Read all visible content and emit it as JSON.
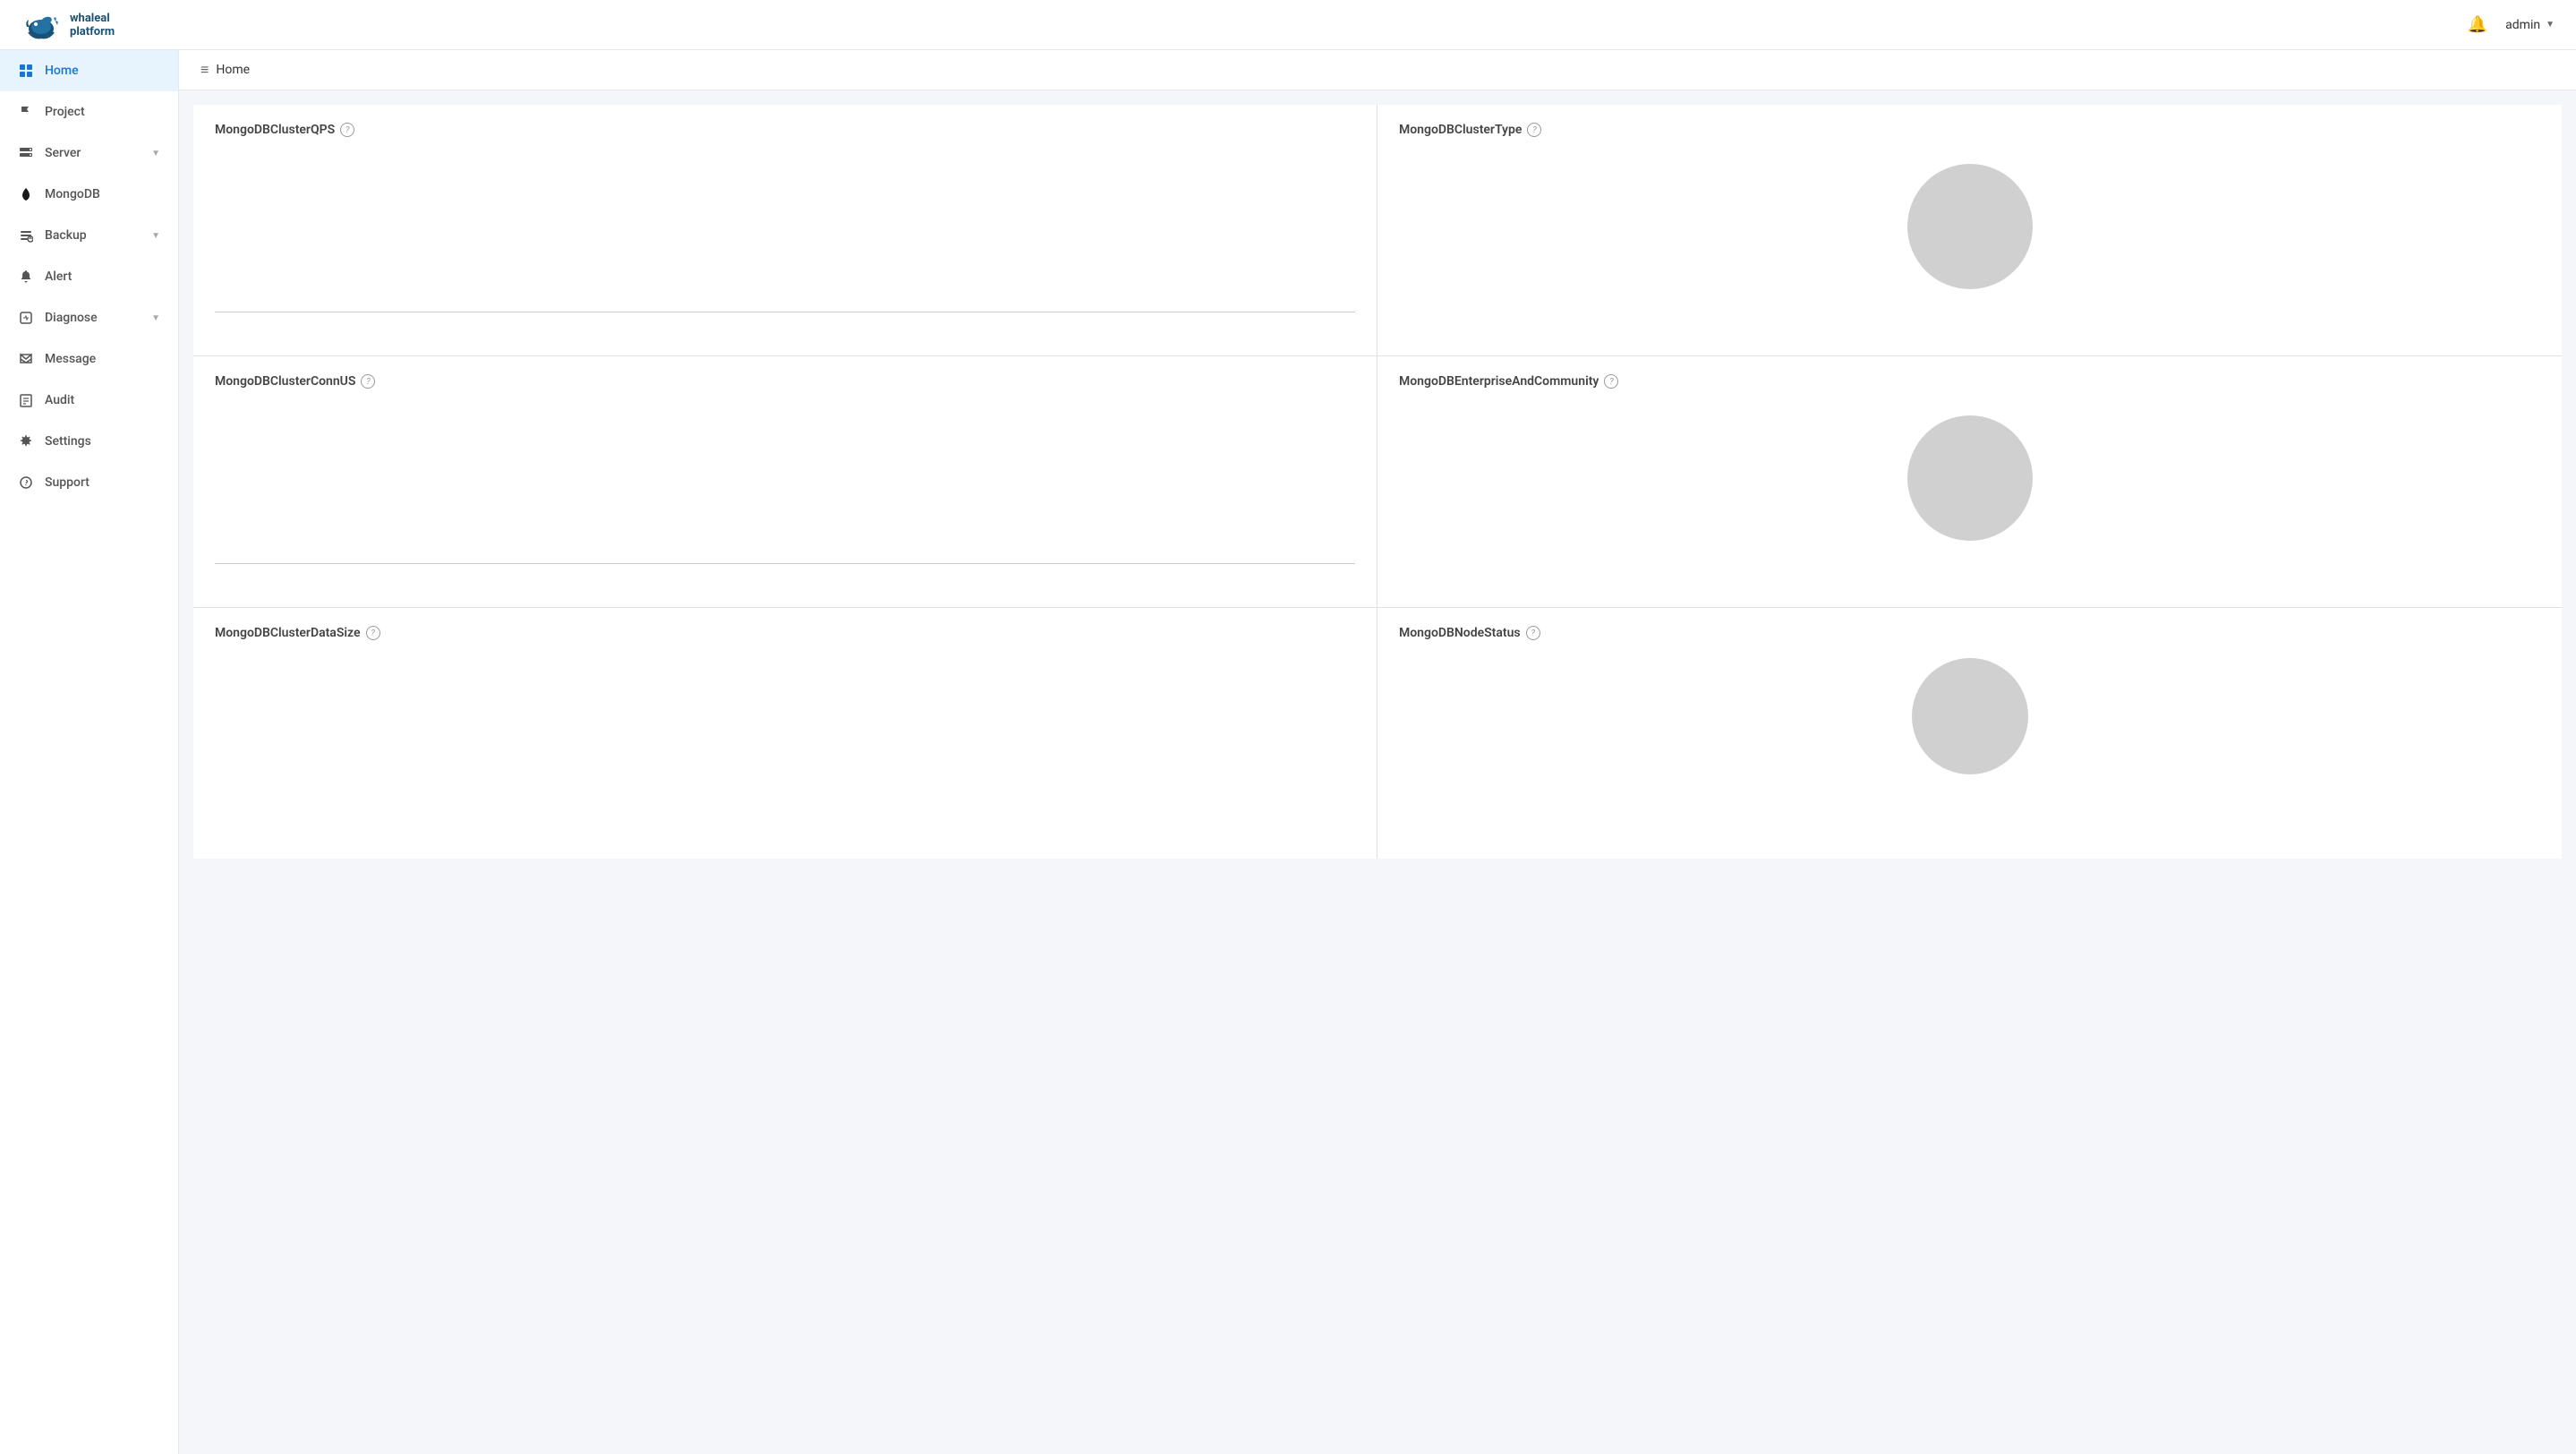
{
  "header": {
    "logo_text_line1": "whaleal",
    "logo_text_line2": "platform",
    "user": "admin",
    "bell_label": "notifications"
  },
  "sidebar": {
    "items": [
      {
        "id": "home",
        "label": "Home",
        "icon": "grid",
        "active": true,
        "has_chevron": false
      },
      {
        "id": "project",
        "label": "Project",
        "icon": "flag",
        "active": false,
        "has_chevron": false
      },
      {
        "id": "server",
        "label": "Server",
        "icon": "server",
        "active": false,
        "has_chevron": true
      },
      {
        "id": "mongodb",
        "label": "MongoDB",
        "icon": "diamond",
        "active": false,
        "has_chevron": false
      },
      {
        "id": "backup",
        "label": "Backup",
        "icon": "backup",
        "active": false,
        "has_chevron": true
      },
      {
        "id": "alert",
        "label": "Alert",
        "icon": "bell",
        "active": false,
        "has_chevron": false
      },
      {
        "id": "diagnose",
        "label": "Diagnose",
        "icon": "diagnose",
        "active": false,
        "has_chevron": true
      },
      {
        "id": "message",
        "label": "Message",
        "icon": "send",
        "active": false,
        "has_chevron": false
      },
      {
        "id": "audit",
        "label": "Audit",
        "icon": "audit",
        "active": false,
        "has_chevron": false
      },
      {
        "id": "settings",
        "label": "Settings",
        "icon": "gear",
        "active": false,
        "has_chevron": false
      },
      {
        "id": "support",
        "label": "Support",
        "icon": "help",
        "active": false,
        "has_chevron": false
      }
    ]
  },
  "breadcrumb": {
    "icon": "≡",
    "label": "Home"
  },
  "widgets": [
    {
      "id": "qps",
      "title": "MongoDBClusterQPS",
      "type": "line",
      "col": 0,
      "row": 0
    },
    {
      "id": "cluster_type",
      "title": "MongoDBClusterType",
      "type": "pie",
      "col": 1,
      "row": 0
    },
    {
      "id": "conn_us",
      "title": "MongoDBClusterConnUS",
      "type": "line",
      "col": 0,
      "row": 1
    },
    {
      "id": "enterprise",
      "title": "MongoDBEnterpriseAndCommunity",
      "type": "pie",
      "col": 1,
      "row": 1
    },
    {
      "id": "data_size",
      "title": "MongoDBClusterDataSize",
      "type": "line",
      "col": 0,
      "row": 2
    },
    {
      "id": "node_status",
      "title": "MongoDBNodeStatus",
      "type": "pie",
      "col": 1,
      "row": 2
    }
  ]
}
